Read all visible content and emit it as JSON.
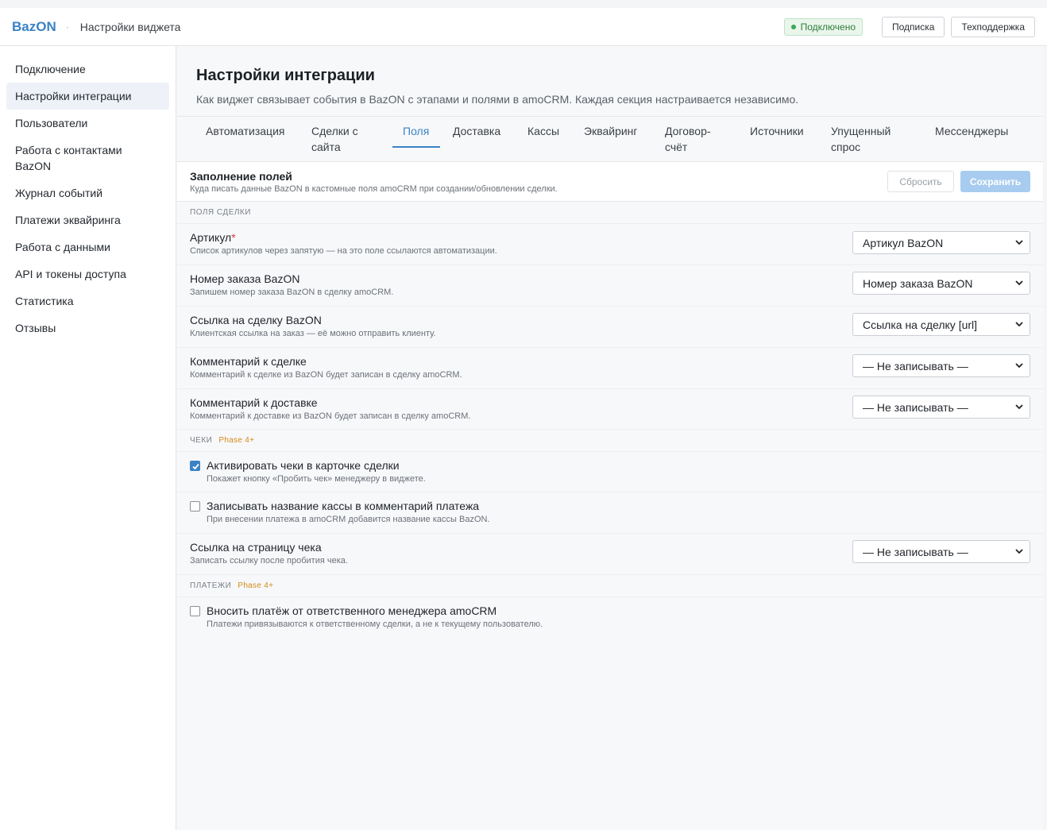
{
  "header": {
    "brand": "BazON",
    "separator": "·",
    "title": "Настройки виджета",
    "status": "Подключено",
    "subscription_label": "Подписка",
    "support_label": "Техподдержка",
    "status_color": "#3aa657"
  },
  "sidebar": {
    "items": [
      {
        "label": "Подключение"
      },
      {
        "label": "Настройки интеграции",
        "active": true
      },
      {
        "label": "Пользователи"
      },
      {
        "label": "Работа с контактами BazON"
      },
      {
        "label": "Журнал событий"
      },
      {
        "label": "Платежи эквайринга"
      },
      {
        "label": "Работа с данными"
      },
      {
        "label": "API и токены доступа"
      },
      {
        "label": "Статистика"
      },
      {
        "label": "Отзывы"
      }
    ]
  },
  "page": {
    "title": "Настройки интеграции",
    "subtitle": "Как виджет связывает события в BazON с этапами и полями в amoCRM. Каждая секция настраивается независимо."
  },
  "tabs": [
    {
      "label": "Автоматизация"
    },
    {
      "label": "Сделки с сайта"
    },
    {
      "label": "Поля",
      "active": true
    },
    {
      "label": "Доставка"
    },
    {
      "label": "Кассы"
    },
    {
      "label": "Эквайринг"
    },
    {
      "label": "Договор-счёт"
    },
    {
      "label": "Источники"
    },
    {
      "label": "Упущенный спрос"
    },
    {
      "label": "Мессенджеры"
    }
  ],
  "section": {
    "title": "Заполнение полей",
    "subtitle": "Куда писать данные BazON в кастомные поля amoCRM при создании/обновлении сделки.",
    "reset_label": "Сбросить",
    "save_label": "Сохранить"
  },
  "groups": {
    "deal_fields": {
      "label": "ПОЛЯ СДЕЛКИ"
    },
    "receipts": {
      "label": "ЧЕКИ",
      "phase": "Phase 4+"
    },
    "payments": {
      "label": "ПЛАТЕЖИ",
      "phase": "Phase 4+"
    }
  },
  "fields": [
    {
      "label": "Артикул",
      "required_mark": "*",
      "hint": "Список артикулов через запятую — на это поле ссылаются автоматизации.",
      "value": "Артикул BazON"
    },
    {
      "label": "Номер заказа BazON",
      "hint": "Запишем номер заказа BazON в сделку amoCRM.",
      "value": "Номер заказа BazON"
    },
    {
      "label": "Ссылка на сделку BazON",
      "hint": "Клиентская ссылка на заказ — её можно отправить клиенту.",
      "value": "Ссылка на сделку [url]"
    },
    {
      "label": "Комментарий к сделке",
      "hint": "Комментарий к сделке из BazON будет записан в сделку amoCRM.",
      "value": "— Не записывать —"
    },
    {
      "label": "Комментарий к доставке",
      "hint": "Комментарий к доставке из BazON будет записан в сделку amoCRM.",
      "value": "— Не записывать —"
    }
  ],
  "receipts": {
    "activate": {
      "label": "Активировать чеки в карточке сделки",
      "hint": "Покажет кнопку «Пробить чек» менеджеру в виджете.",
      "checked": true
    },
    "cashbox_name": {
      "label": "Записывать название кассы в комментарий платежа",
      "hint": "При внесении платежа в amoCRM добавится название кассы BazON.",
      "checked": false
    },
    "receipt_link": {
      "label": "Ссылка на страницу чека",
      "hint": "Записать ссылку после пробития чека.",
      "value": "— Не записывать —"
    }
  },
  "payments": {
    "responsible": {
      "label": "Вносить платёж от ответственного менеджера amoCRM",
      "hint": "Платежи привязываются к ответственному сделки, а не к текущему пользователю.",
      "checked": false
    }
  },
  "colors": {
    "accent": "#3b82c4",
    "phase": "#d48a1a",
    "required": "#d9363e"
  }
}
